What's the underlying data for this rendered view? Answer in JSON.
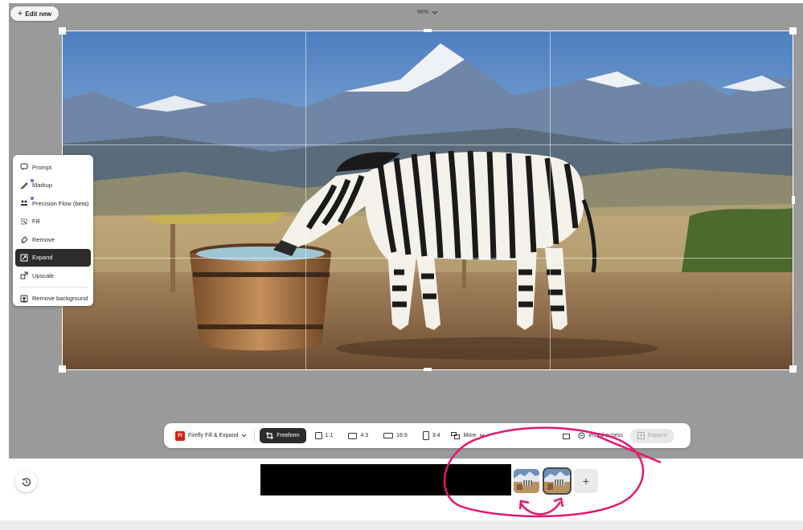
{
  "top": {
    "edit_new_label": "Edit new",
    "zoom_value": "98%"
  },
  "tool_menu": {
    "items": [
      {
        "label": "Prompt",
        "icon": "prompt-icon"
      },
      {
        "label": "Markup",
        "icon": "markup-icon"
      },
      {
        "label": "Precision Flow (beta)",
        "icon": "precision-flow-icon"
      },
      {
        "label": "Fill",
        "icon": "fill-icon"
      },
      {
        "label": "Remove",
        "icon": "remove-icon"
      },
      {
        "label": "Expand",
        "icon": "expand-icon",
        "active": true
      },
      {
        "label": "Upscale",
        "icon": "upscale-icon"
      },
      {
        "label": "Remove background",
        "icon": "remove-background-icon"
      }
    ]
  },
  "toolbar": {
    "model_label": "Firefly Fill & Expand",
    "model_logo": "Fi",
    "freeform_label": "Freeform",
    "ratio_1_1": "1:1",
    "ratio_4_3": "4:3",
    "ratio_16_9": "16:9",
    "ratio_3_4": "3:4",
    "more_label": "More",
    "access_label": "imited access",
    "expand_label": "Expand"
  },
  "bottom": {
    "add_label": "+"
  },
  "colors": {
    "stage_bg": "#9a9a9a",
    "active_tool_bg": "#2c2c2c",
    "brand_red": "#d6211a",
    "annotation_pink": "#e3176f"
  }
}
